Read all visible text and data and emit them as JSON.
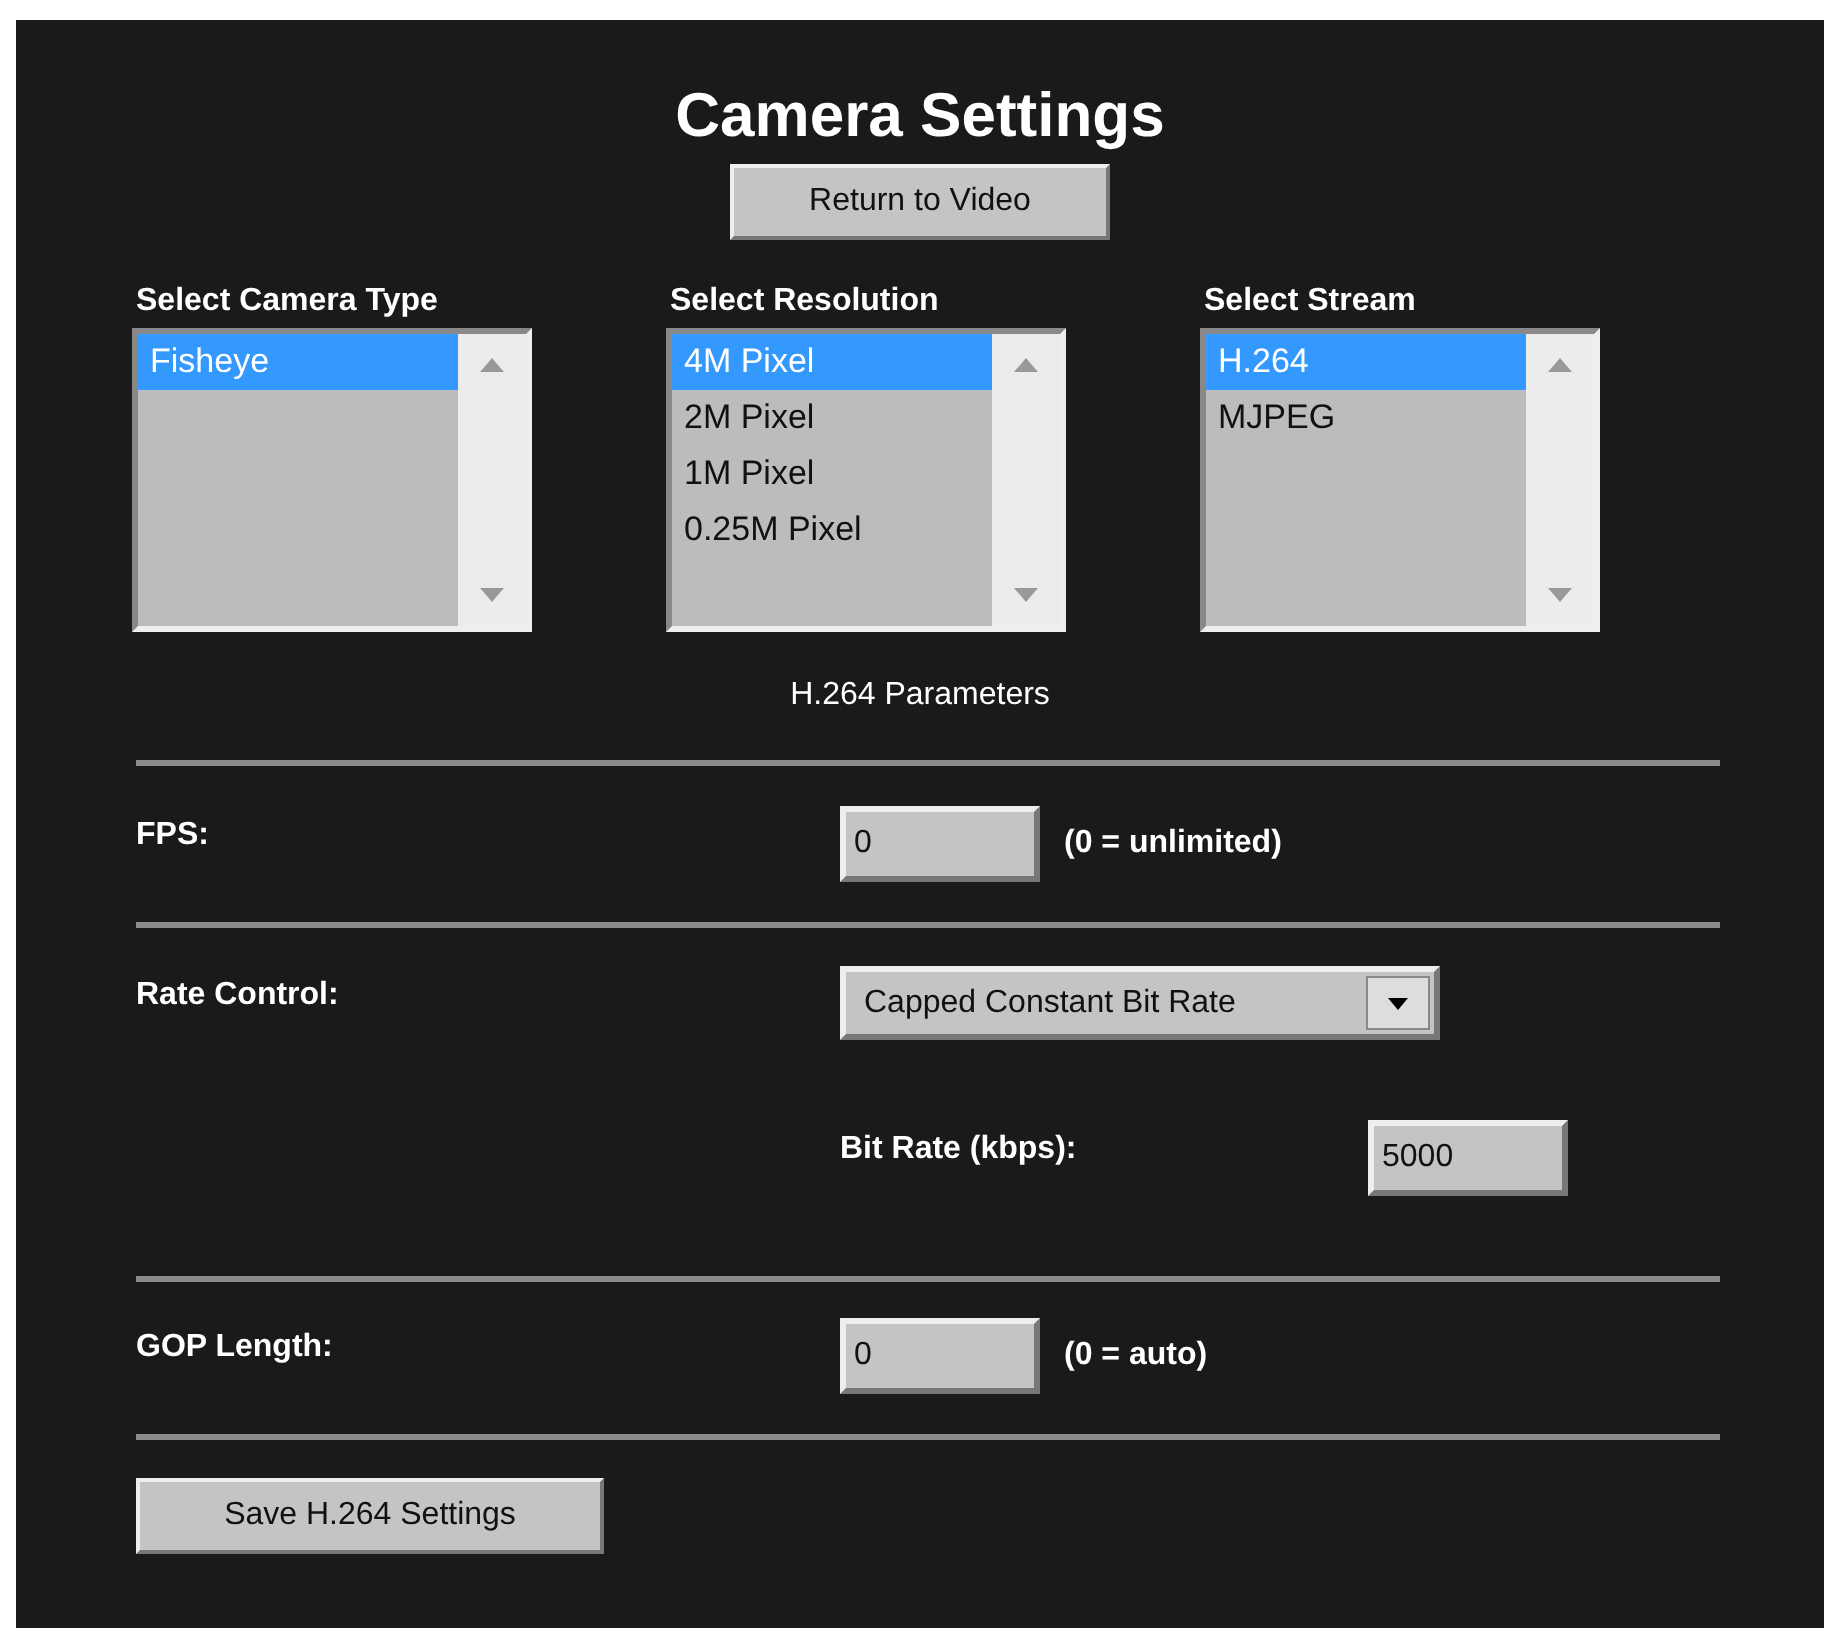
{
  "title": "Camera Settings",
  "return_button": "Return to Video",
  "lists": [
    {
      "title": "Select Camera Type",
      "items": [
        {
          "label": "Fisheye",
          "selected": true
        }
      ]
    },
    {
      "title": "Select Resolution",
      "items": [
        {
          "label": "4M Pixel",
          "selected": true
        },
        {
          "label": "2M Pixel",
          "selected": false
        },
        {
          "label": "1M Pixel",
          "selected": false
        },
        {
          "label": "0.25M Pixel",
          "selected": false
        }
      ]
    },
    {
      "title": "Select Stream",
      "items": [
        {
          "label": "H.264",
          "selected": true
        },
        {
          "label": "MJPEG",
          "selected": false
        }
      ]
    }
  ],
  "section_heading": "H.264 Parameters",
  "fps": {
    "label": "FPS:",
    "value": "0",
    "hint": "(0 = unlimited)"
  },
  "rate_control": {
    "label": "Rate Control:",
    "value": "Capped Constant Bit Rate"
  },
  "bit_rate": {
    "label": "Bit Rate (kbps):",
    "value": "5000"
  },
  "gop_length": {
    "label": "GOP Length:",
    "value": "0",
    "hint": "(0 = auto)"
  },
  "save_button": "Save H.264 Settings"
}
